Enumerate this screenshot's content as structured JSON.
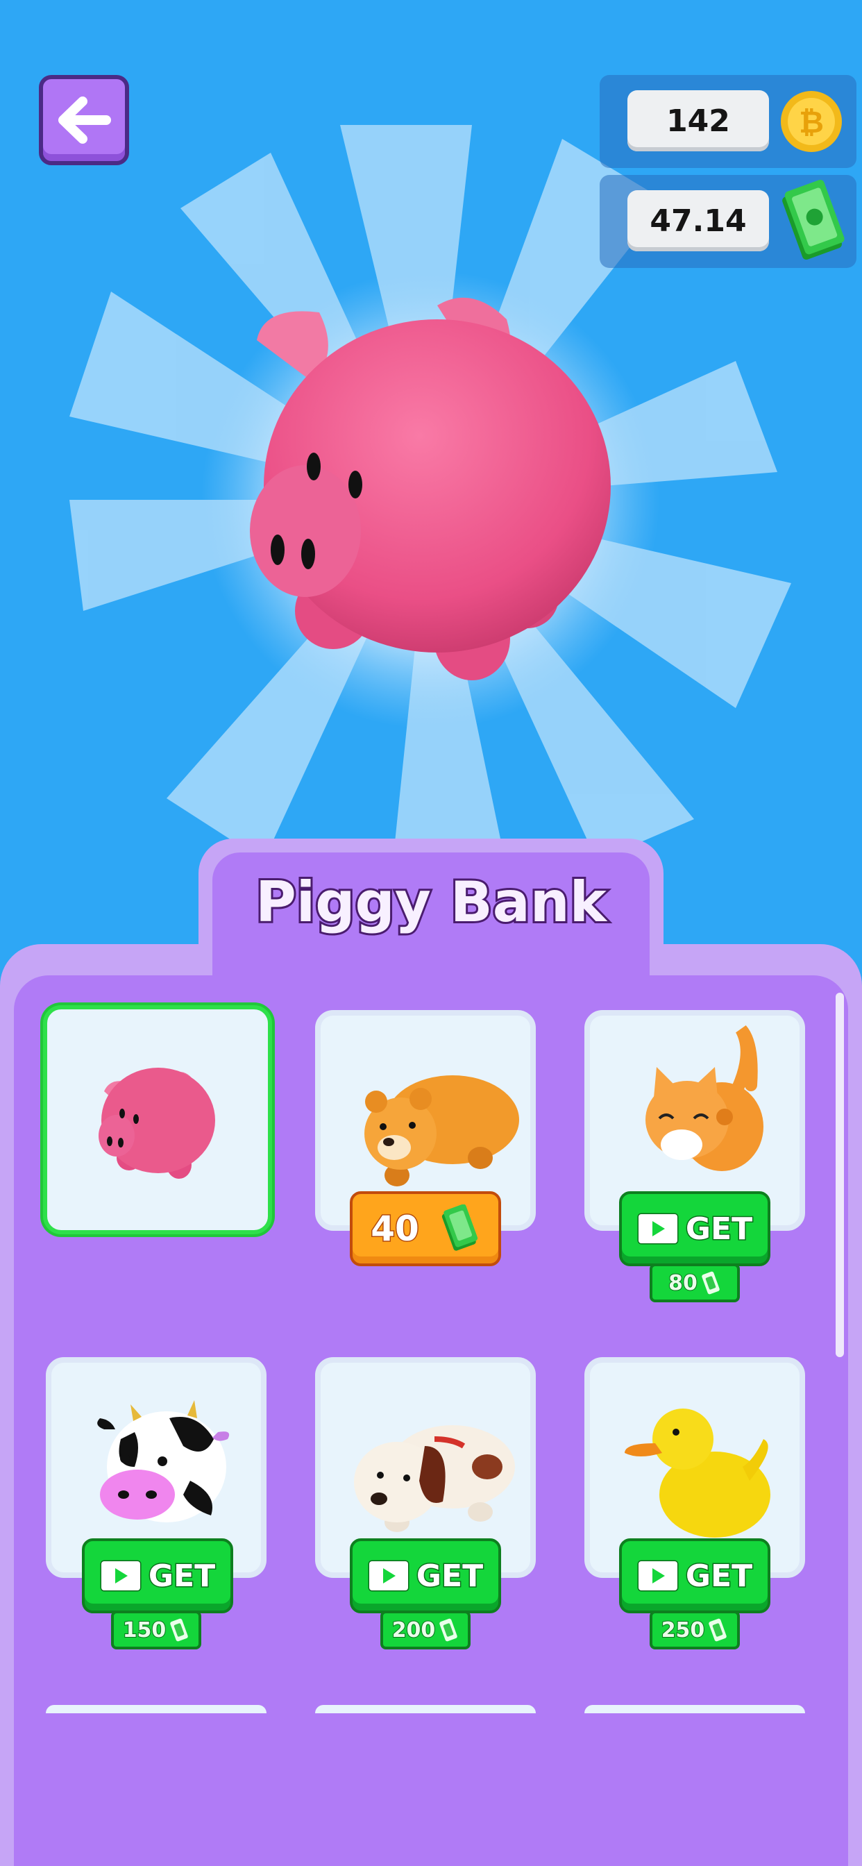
{
  "header": {
    "coins": "142",
    "cash": "47.14",
    "coin_icon": "bitcoin-coin-icon",
    "cash_icon": "cash-stack-icon",
    "back_icon": "arrow-left-icon"
  },
  "featured": {
    "icon": "piggy-bank-model"
  },
  "shop": {
    "title": "Piggy Bank",
    "items": [
      {
        "icon": "piggy-icon",
        "state": "selected"
      },
      {
        "icon": "bear-icon",
        "state": "buy",
        "price": "40"
      },
      {
        "icon": "cat-icon",
        "state": "get",
        "label": "GET",
        "price": "80"
      },
      {
        "icon": "cow-icon",
        "state": "get",
        "label": "GET",
        "price": "150"
      },
      {
        "icon": "dog-icon",
        "state": "get",
        "label": "GET",
        "price": "200"
      },
      {
        "icon": "duck-icon",
        "state": "get",
        "label": "GET",
        "price": "250"
      }
    ]
  },
  "colors": {
    "sky": "#2ea7f5",
    "panel": "#b07bf6",
    "panel_border": "#c6a5f6",
    "get_green": "#14d63b",
    "buy_orange": "#ffa51c"
  }
}
